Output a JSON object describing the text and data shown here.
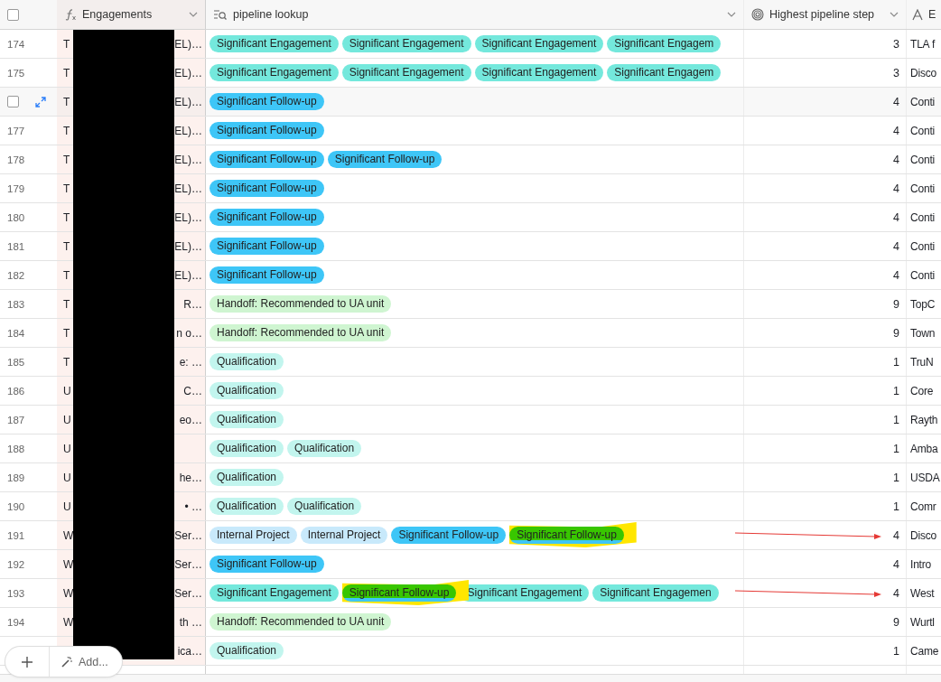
{
  "header_checkbox": {
    "checked": false
  },
  "columns": [
    {
      "kind": "formula",
      "label": "Engagements",
      "menu": true
    },
    {
      "kind": "lookup",
      "label": "pipeline lookup",
      "menu": true
    },
    {
      "kind": "rollup",
      "label": "Highest pipeline step",
      "menu": true
    },
    {
      "kind": "text",
      "label": "E"
    }
  ],
  "rows": [
    {
      "number": "174",
      "hovered": false,
      "engagement_start": "T",
      "engagement_end": "EL)…",
      "tags": [
        {
          "label": "Significant Engagement",
          "color": "#74e8dc",
          "highlighted": false
        },
        {
          "label": "Significant Engagement",
          "color": "#74e8dc",
          "highlighted": false
        },
        {
          "label": "Significant Engagement",
          "color": "#74e8dc",
          "highlighted": false
        },
        {
          "label": "Significant Engagem",
          "color": "#74e8dc",
          "highlighted": false
        }
      ],
      "step": "3",
      "column_5": "TLA f"
    },
    {
      "number": "175",
      "hovered": false,
      "engagement_start": "T",
      "engagement_end": "EL)…",
      "tags": [
        {
          "label": "Significant Engagement",
          "color": "#74e8dc",
          "highlighted": false
        },
        {
          "label": "Significant Engagement",
          "color": "#74e8dc",
          "highlighted": false
        },
        {
          "label": "Significant Engagement",
          "color": "#74e8dc",
          "highlighted": false
        },
        {
          "label": "Significant Engagem",
          "color": "#74e8dc",
          "highlighted": false
        }
      ],
      "step": "3",
      "column_5": "Disco"
    },
    {
      "hovered": true,
      "checked": false,
      "engagement_start": "T",
      "engagement_end": "EL)…",
      "tags": [
        {
          "label": "Significant Follow-up",
          "color": "#3ec6f7",
          "highlighted": false
        }
      ],
      "step": "4",
      "column_5": "Conti"
    },
    {
      "number": "177",
      "hovered": false,
      "engagement_start": "T",
      "engagement_end": "EL)…",
      "tags": [
        {
          "label": "Significant Follow-up",
          "color": "#3ec6f7",
          "highlighted": false
        }
      ],
      "step": "4",
      "column_5": "Conti"
    },
    {
      "number": "178",
      "hovered": false,
      "engagement_start": "T",
      "engagement_end": "EL)…",
      "tags": [
        {
          "label": "Significant Follow-up",
          "color": "#3ec6f7",
          "highlighted": false
        },
        {
          "label": "Significant Follow-up",
          "color": "#3ec6f7",
          "highlighted": false
        }
      ],
      "step": "4",
      "column_5": "Conti"
    },
    {
      "number": "179",
      "hovered": false,
      "engagement_start": "T",
      "engagement_end": "EL)…",
      "tags": [
        {
          "label": "Significant Follow-up",
          "color": "#3ec6f7",
          "highlighted": false
        }
      ],
      "step": "4",
      "column_5": "Conti"
    },
    {
      "number": "180",
      "hovered": false,
      "engagement_start": "T",
      "engagement_end": "EL)…",
      "tags": [
        {
          "label": "Significant Follow-up",
          "color": "#3ec6f7",
          "highlighted": false
        }
      ],
      "step": "4",
      "column_5": "Conti"
    },
    {
      "number": "181",
      "hovered": false,
      "engagement_start": "T",
      "engagement_end": "EL)…",
      "tags": [
        {
          "label": "Significant Follow-up",
          "color": "#3ec6f7",
          "highlighted": false
        }
      ],
      "step": "4",
      "column_5": "Conti"
    },
    {
      "number": "182",
      "hovered": false,
      "engagement_start": "T",
      "engagement_end": "EL)…",
      "tags": [
        {
          "label": "Significant Follow-up",
          "color": "#3ec6f7",
          "highlighted": false
        }
      ],
      "step": "4",
      "column_5": "Conti"
    },
    {
      "number": "183",
      "hovered": false,
      "engagement_start": "T",
      "engagement_end": "R…",
      "tags": [
        {
          "label": "Handoff: Recommended to UA unit",
          "color": "#cff5d1",
          "highlighted": false
        }
      ],
      "step": "9",
      "column_5": "TopC"
    },
    {
      "number": "184",
      "hovered": false,
      "engagement_start": "T",
      "engagement_end": "n o…",
      "tags": [
        {
          "label": "Handoff: Recommended to UA unit",
          "color": "#cff5d1",
          "highlighted": false
        }
      ],
      "step": "9",
      "column_5": "Town"
    },
    {
      "number": "185",
      "hovered": false,
      "engagement_start": "T",
      "engagement_end": "e: …",
      "tags": [
        {
          "label": "Qualification",
          "color": "#c2f5ee",
          "highlighted": false
        }
      ],
      "step": "1",
      "column_5": "TruN"
    },
    {
      "number": "186",
      "hovered": false,
      "engagement_start": "U",
      "engagement_end": "C…",
      "tags": [
        {
          "label": "Qualification",
          "color": "#c2f5ee",
          "highlighted": false
        }
      ],
      "step": "1",
      "column_5": "Core"
    },
    {
      "number": "187",
      "hovered": false,
      "engagement_start": "U",
      "engagement_end": "eo…",
      "tags": [
        {
          "label": "Qualification",
          "color": "#c2f5ee",
          "highlighted": false
        }
      ],
      "step": "1",
      "column_5": "Rayth"
    },
    {
      "number": "188",
      "hovered": false,
      "engagement_start": "U",
      "tags": [
        {
          "label": "Qualification",
          "color": "#c2f5ee",
          "highlighted": false
        },
        {
          "label": "Qualification",
          "color": "#c2f5ee",
          "highlighted": false
        }
      ],
      "step": "1",
      "column_5": "Amba"
    },
    {
      "number": "189",
      "hovered": false,
      "engagement_start": "U",
      "engagement_end": "he…",
      "tags": [
        {
          "label": "Qualification",
          "color": "#c2f5ee",
          "highlighted": false
        }
      ],
      "step": "1",
      "column_5": "USDA"
    },
    {
      "number": "190",
      "hovered": false,
      "engagement_start": "U",
      "engagement_end": "• …",
      "tags": [
        {
          "label": "Qualification",
          "color": "#c2f5ee",
          "highlighted": false
        },
        {
          "label": "Qualification",
          "color": "#c2f5ee",
          "highlighted": false
        }
      ],
      "step": "1",
      "column_5": "Comr"
    },
    {
      "number": "191",
      "hovered": false,
      "engagement_start": "W",
      "engagement_end": "Ser…",
      "tags": [
        {
          "label": "Internal Project",
          "color": "#c8e9fb",
          "highlighted": false
        },
        {
          "label": "Internal Project",
          "color": "#c8e9fb",
          "highlighted": false
        },
        {
          "label": "Significant Follow-up",
          "color": "#3ec6f7",
          "highlighted": false
        },
        {
          "label": "Significant Follow-up",
          "color": "#3ec6f7",
          "highlighted": true
        }
      ],
      "step": "4",
      "column_5": "Disco"
    },
    {
      "number": "192",
      "hovered": false,
      "engagement_start": "W",
      "engagement_end": "Ser…",
      "tags": [
        {
          "label": "Significant Follow-up",
          "color": "#3ec6f7",
          "highlighted": false
        }
      ],
      "step": "4",
      "column_5": "Intro"
    },
    {
      "number": "193",
      "hovered": false,
      "engagement_start": "W",
      "engagement_end": "Ser…",
      "tags": [
        {
          "label": "Significant Engagement",
          "color": "#74e8dc",
          "highlighted": false
        },
        {
          "label": "Significant Follow-up",
          "color": "#3ec6f7",
          "highlighted": true
        },
        {
          "label": "Significant Engagement",
          "color": "#74e8dc",
          "highlighted": false
        },
        {
          "label": "Significant Engagemen",
          "color": "#74e8dc",
          "highlighted": false
        }
      ],
      "step": "4",
      "column_5": "West"
    },
    {
      "number": "194",
      "hovered": false,
      "engagement_start": "W",
      "engagement_end": "th …",
      "tags": [
        {
          "label": "Handoff: Recommended to UA unit",
          "color": "#cff5d1",
          "highlighted": false
        }
      ],
      "step": "9",
      "column_5": "Wurtl"
    },
    {
      "hovered": false,
      "engagement_end": "ica…",
      "tags": [
        {
          "label": "Qualification",
          "color": "#c2f5ee",
          "highlighted": false
        }
      ],
      "step": "1",
      "column_5": "Came"
    }
  ],
  "redaction_bar": true,
  "add_button": {
    "label": "Add..."
  }
}
